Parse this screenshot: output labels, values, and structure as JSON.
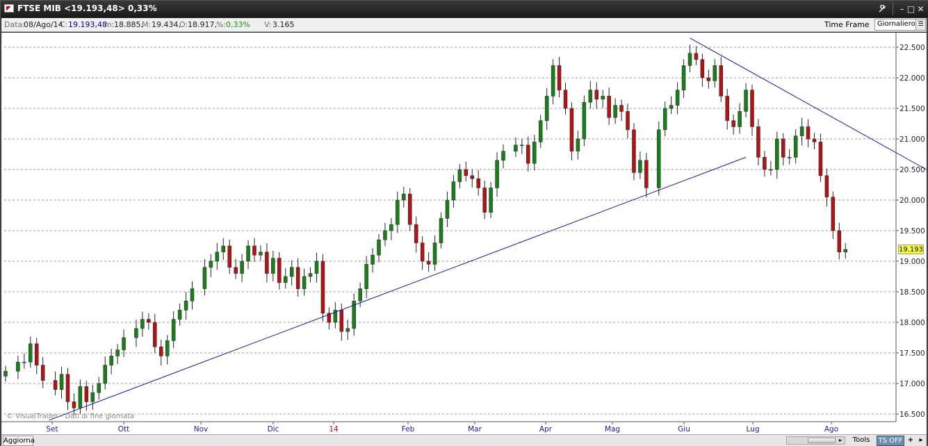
{
  "window": {
    "title": "FTSE MIB <19.193,48> 0,33%",
    "controls": {
      "tools_icon": "wrench-icon",
      "minimize": "–",
      "restore": "□",
      "close": "✕"
    }
  },
  "info": {
    "date_label": "Data:",
    "date_value": "08/Ago/14",
    "close_label": "C:",
    "close_value": "19.193,48",
    "low_label": "m:",
    "low_value": "18.885,",
    "high_label": "M:",
    "high_value": "19.434,",
    "open_label": "O:",
    "open_value": "18.917,",
    "pct_label": "%:",
    "pct_value": "0,33%",
    "volume_label": "V:",
    "volume_value": "3.165",
    "timeframe_label": "Time Frame",
    "timeframe_value": "Giornaliero"
  },
  "watermark": "© VisualTrader - Dati di fine giornata",
  "last_price_tag": "19.193",
  "bottom": {
    "refresh_label": "Aggiorna",
    "tools_label": "Tools",
    "ts_label": "TS OFF",
    "add_label": "+",
    "menu_label": "▸"
  },
  "colors": {
    "up": "#1a7f1a",
    "down": "#b01414",
    "trendline": "#1a1a9a",
    "grid": "#999999"
  },
  "chart_data": {
    "type": "candlestick",
    "ylim": [
      16500,
      22500
    ],
    "y_ticks": [
      "16.500",
      "17.000",
      "17.500",
      "18.000",
      "18.500",
      "19.000",
      "19.500",
      "20.000",
      "20.500",
      "21.000",
      "21.500",
      "22.000",
      "22.500"
    ],
    "x_labels": [
      "Set",
      "Ott",
      "Nov",
      "Dic",
      "14",
      "Feb",
      "Mar",
      "Apr",
      "Mag",
      "Giu",
      "Lug",
      "Ago"
    ],
    "points": [
      [
        0,
        17200
      ],
      [
        2,
        17350
      ],
      [
        3,
        17350
      ],
      [
        4,
        17650
      ],
      [
        5,
        17300
      ],
      [
        6,
        17050
      ],
      [
        8,
        16900
      ],
      [
        9,
        17150
      ],
      [
        10,
        16700
      ],
      [
        11,
        16600
      ],
      [
        12,
        16950
      ],
      [
        13,
        16700
      ],
      [
        14,
        16850
      ],
      [
        15,
        17000
      ],
      [
        16,
        17300
      ],
      [
        17,
        17450
      ],
      [
        18,
        17550
      ],
      [
        19,
        17750
      ],
      [
        21,
        17900
      ],
      [
        22,
        18050
      ],
      [
        23,
        18000
      ],
      [
        24,
        17600
      ],
      [
        25,
        17450
      ],
      [
        26,
        17700
      ],
      [
        27,
        18050
      ],
      [
        28,
        18200
      ],
      [
        29,
        18350
      ],
      [
        30,
        18550
      ],
      [
        32,
        18900
      ],
      [
        33,
        19000
      ],
      [
        34,
        19150
      ],
      [
        35,
        19250
      ],
      [
        36,
        18900
      ],
      [
        37,
        18800
      ],
      [
        38,
        19000
      ],
      [
        39,
        19250
      ],
      [
        40,
        19100
      ],
      [
        41,
        19150
      ],
      [
        42,
        18800
      ],
      [
        43,
        19050
      ],
      [
        44,
        18650
      ],
      [
        45,
        18750
      ],
      [
        46,
        18900
      ],
      [
        47,
        18550
      ],
      [
        48,
        18750
      ],
      [
        49,
        18800
      ],
      [
        50,
        19000
      ],
      [
        51,
        18150
      ],
      [
        52,
        18000
      ],
      [
        53,
        18200
      ],
      [
        54,
        17850
      ],
      [
        55,
        17900
      ],
      [
        56,
        18350
      ],
      [
        57,
        18550
      ],
      [
        58,
        18950
      ],
      [
        59,
        19100
      ],
      [
        60,
        19350
      ],
      [
        61,
        19500
      ],
      [
        62,
        19600
      ],
      [
        63,
        20000
      ],
      [
        64,
        20100
      ],
      [
        65,
        19600
      ],
      [
        66,
        19300
      ],
      [
        67,
        19000
      ],
      [
        68,
        18950
      ],
      [
        69,
        19300
      ],
      [
        70,
        19700
      ],
      [
        71,
        20000
      ],
      [
        72,
        20300
      ],
      [
        73,
        20500
      ],
      [
        74,
        20400
      ],
      [
        75,
        20350
      ],
      [
        76,
        20200
      ],
      [
        77,
        19800
      ],
      [
        78,
        20200
      ],
      [
        79,
        20650
      ],
      [
        80,
        20800
      ],
      [
        82,
        20900
      ],
      [
        83,
        20900
      ],
      [
        84,
        20600
      ],
      [
        85,
        20950
      ],
      [
        86,
        21300
      ],
      [
        87,
        21700
      ],
      [
        88,
        22200
      ],
      [
        89,
        21800
      ],
      [
        90,
        21500
      ],
      [
        91,
        20800
      ],
      [
        92,
        21000
      ],
      [
        93,
        21600
      ],
      [
        94,
        21800
      ],
      [
        95,
        21650
      ],
      [
        96,
        21700
      ],
      [
        97,
        21350
      ],
      [
        98,
        21550
      ],
      [
        99,
        21450
      ],
      [
        100,
        21150
      ],
      [
        101,
        20450
      ],
      [
        102,
        20650
      ],
      [
        103,
        20200
      ],
      [
        105,
        21150
      ],
      [
        106,
        21500
      ],
      [
        107,
        21550
      ],
      [
        108,
        21800
      ],
      [
        109,
        22200
      ],
      [
        110,
        22400
      ],
      [
        111,
        22300
      ],
      [
        112,
        22000
      ],
      [
        113,
        21950
      ],
      [
        114,
        22200
      ],
      [
        115,
        21700
      ],
      [
        116,
        21300
      ],
      [
        117,
        21200
      ],
      [
        118,
        21450
      ],
      [
        119,
        21800
      ],
      [
        120,
        21200
      ],
      [
        121,
        20700
      ],
      [
        122,
        20500
      ],
      [
        123,
        20500
      ],
      [
        124,
        21000
      ],
      [
        125,
        20700
      ],
      [
        126,
        20700
      ],
      [
        127,
        21050
      ],
      [
        128,
        21200
      ],
      [
        129,
        21000
      ],
      [
        130,
        20950
      ],
      [
        131,
        20400
      ],
      [
        132,
        20050
      ],
      [
        133,
        19500
      ],
      [
        134,
        19150
      ],
      [
        135,
        19193
      ]
    ],
    "trendlines": [
      {
        "from": [
          7,
          16400
        ],
        "to": [
          119,
          20700
        ]
      },
      {
        "from": [
          110,
          22650
        ],
        "to": [
          148,
          20500
        ]
      }
    ]
  }
}
